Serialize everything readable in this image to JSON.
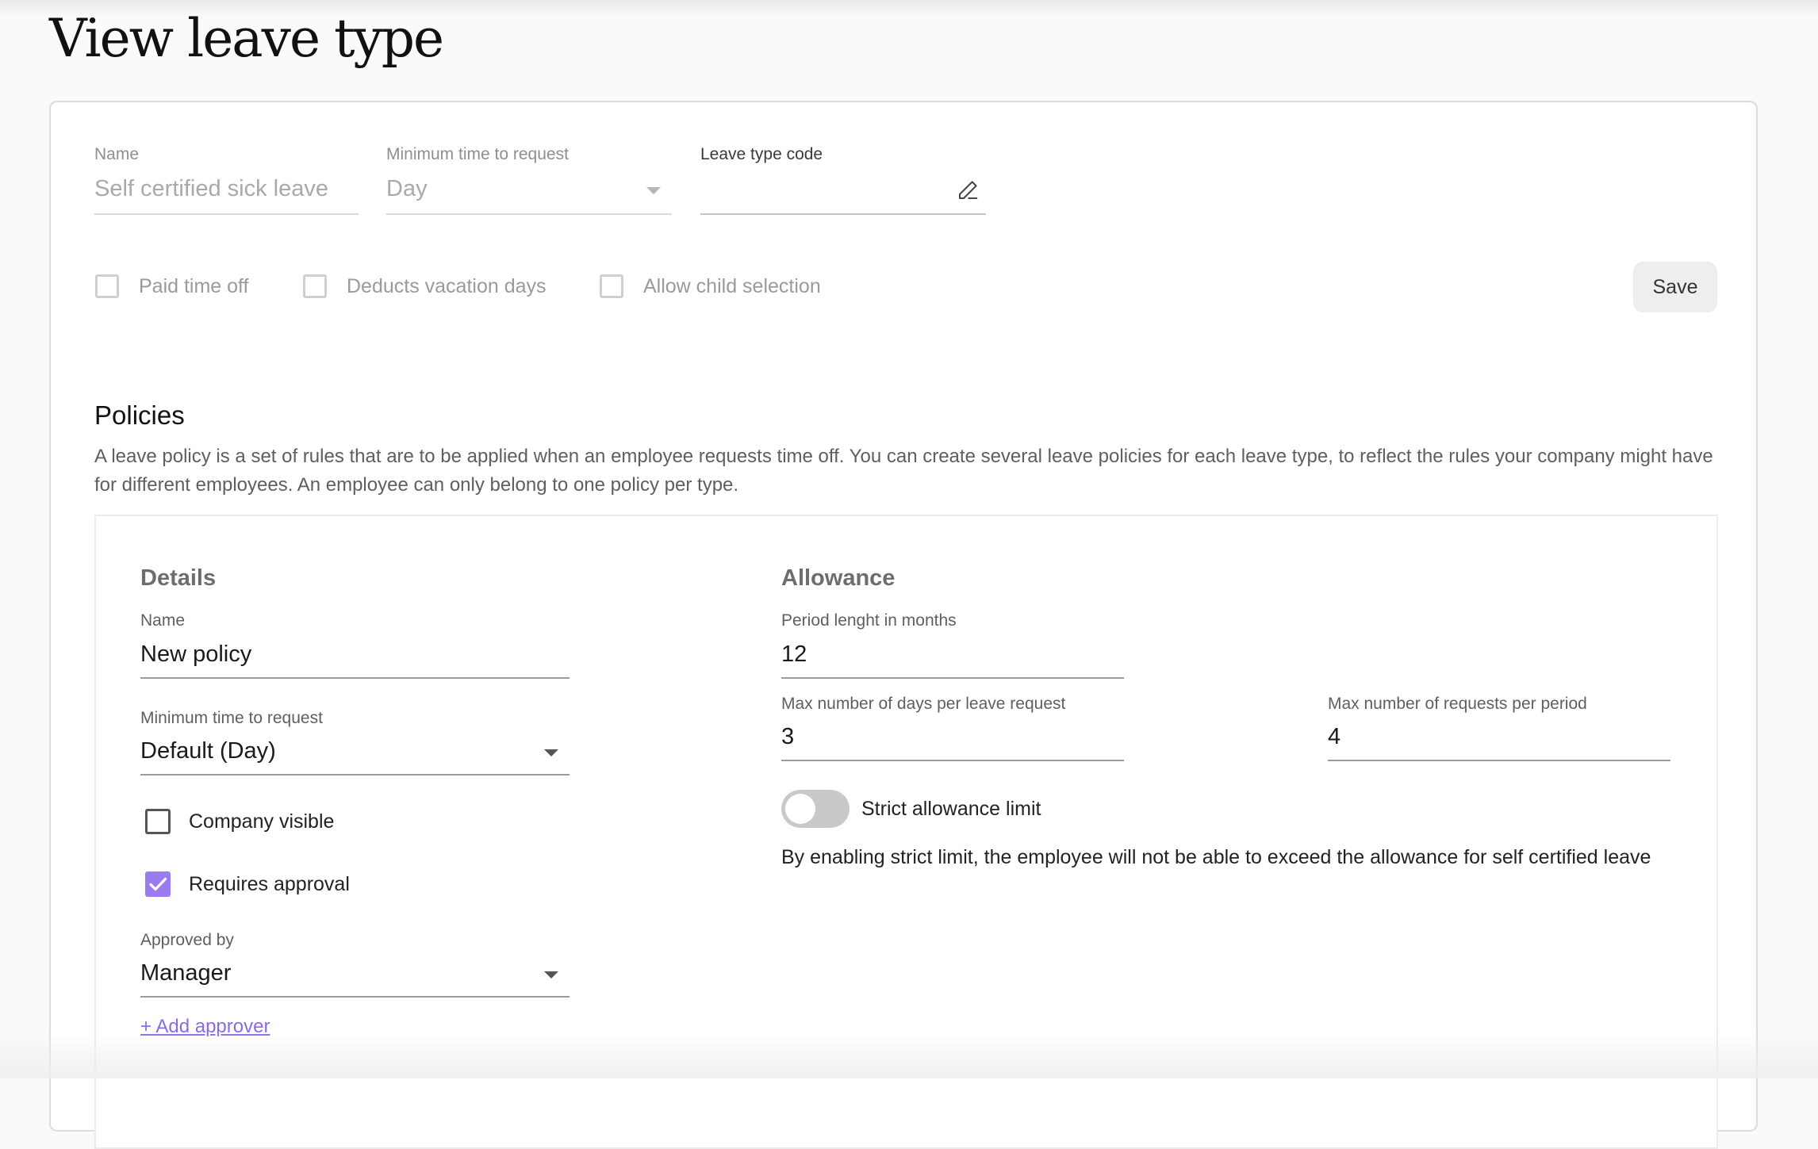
{
  "page": {
    "title": "View leave type"
  },
  "leave_type": {
    "name": {
      "label": "Name",
      "value": "Self certified sick leave"
    },
    "min_time": {
      "label": "Minimum time to request",
      "value": "Day"
    },
    "code": {
      "label": "Leave type code",
      "value": "",
      "icon": "pencil-icon"
    },
    "checkboxes": [
      {
        "label": "Paid time off",
        "checked": false
      },
      {
        "label": "Deducts vacation days",
        "checked": false
      },
      {
        "label": "Allow child selection",
        "checked": false
      }
    ],
    "save_label": "Save"
  },
  "policies": {
    "title": "Policies",
    "description": "A leave policy is a set of rules that are to be applied when an employee requests time off. You can create several leave policies for each leave type, to reflect the rules your company might have for different employees. An employee can only belong to one policy per type.",
    "details": {
      "heading": "Details",
      "name": {
        "label": "Name",
        "value": "New policy"
      },
      "min_time": {
        "label": "Minimum time to request",
        "value": "Default (Day)"
      },
      "company_visible": {
        "label": "Company visible",
        "checked": false
      },
      "requires_approval": {
        "label": "Requires approval",
        "checked": true
      },
      "approved_by": {
        "label": "Approved by",
        "value": "Manager"
      },
      "add_approver": "+ Add approver"
    },
    "allowance": {
      "heading": "Allowance",
      "period": {
        "label": "Period lenght in months",
        "value": "12"
      },
      "max_days": {
        "label": "Max number of days per leave request",
        "value": "3"
      },
      "max_requests": {
        "label": "Max number of requests per period",
        "value": "4"
      },
      "strict": {
        "label": "Strict allowance limit",
        "enabled": false
      },
      "hint": "By enabling strict limit, the employee will not be able to exceed the allowance for self certified leave"
    }
  },
  "colors": {
    "accent": "#9a7cf0",
    "link": "#8a6ae6",
    "toggle_off": "#c9c9c9"
  }
}
